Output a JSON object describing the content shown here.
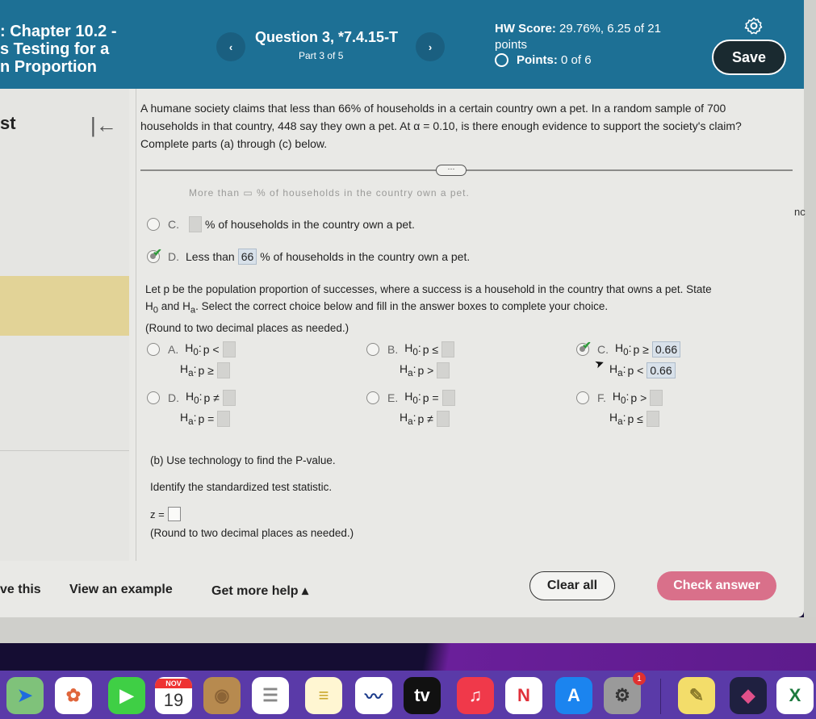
{
  "header": {
    "title_lines": [
      ": Chapter 10.2 -",
      "s Testing for a",
      "n Proportion"
    ],
    "question_title": "Question 3, *7.4.15-T",
    "question_part": "Part 3 of 5",
    "prev_icon": "‹",
    "next_icon": "›",
    "hw_score_label": "HW Score:",
    "hw_score_value": "29.76%, 6.25 of 21 points",
    "points_label": "Points:",
    "points_value": "0 of 6",
    "save_label": "Save"
  },
  "sidebar": {
    "title": "st",
    "collapse_icon": "|←"
  },
  "problem": {
    "text": "A humane society claims that less than 66% of households in a certain country own a pet. In a random sample of 700 households in that country, 448 say they own a pet. At α = 0.10, is there enough evidence to support the society's claim? Complete parts (a) through (c) below.",
    "more_label": "···",
    "faded_text": "More than ▭ % of households in the country own a pet."
  },
  "claim_options": [
    {
      "letter": "C.",
      "prefix": "",
      "value": "",
      "suffix": "% of households in the country own a pet.",
      "selected": false
    },
    {
      "letter": "D.",
      "prefix": "Less than",
      "value": "66",
      "suffix": "% of households in the country own a pet.",
      "selected": true
    }
  ],
  "instructions": {
    "line1": "Let p be the population proportion of successes, where a success is a household in the country that owns a pet. State",
    "h0": "H",
    "h0_sub": "0",
    "and": "and",
    "ha": "H",
    "ha_sub": "a",
    "line2_rest": ". Select the correct choice below and fill in the answer boxes to complete your choice.",
    "round_note": "(Round to two decimal places as needed.)"
  },
  "hypothesis_options": [
    {
      "letter": "A.",
      "h0_op": "p <",
      "ha_op": "p ≥",
      "h0_value": "",
      "ha_value": "",
      "selected": false
    },
    {
      "letter": "B.",
      "h0_op": "p ≤",
      "ha_op": "p >",
      "h0_value": "",
      "ha_value": "",
      "selected": false
    },
    {
      "letter": "C.",
      "h0_op": "p ≥",
      "ha_op": "p <",
      "h0_value": "0.66",
      "ha_value": "0.66",
      "selected": true
    },
    {
      "letter": "D.",
      "h0_op": "p ≠",
      "ha_op": "p =",
      "h0_value": "",
      "ha_value": "",
      "selected": false
    },
    {
      "letter": "E.",
      "h0_op": "p =",
      "ha_op": "p ≠",
      "h0_value": "",
      "ha_value": "",
      "selected": false
    },
    {
      "letter": "F.",
      "h0_op": "p >",
      "ha_op": "p ≤",
      "h0_value": "",
      "ha_value": "",
      "selected": false
    }
  ],
  "part_b": {
    "heading": "(b) Use technology to find the P-value.",
    "identify": "Identify the standardized test statistic.",
    "z_label": "z =",
    "z_value": "",
    "round_note": "(Round to two decimal places as needed.)"
  },
  "side_text": "nc",
  "footer": {
    "solve_label": "ve this",
    "example_label": "View an example",
    "help_label": "Get more help ▴",
    "clear_label": "Clear all",
    "check_label": "Check answer"
  },
  "dock": {
    "apps": [
      {
        "name": "maps",
        "glyph": "➤",
        "bg": "#7fc27a",
        "fg": "#1e6be0"
      },
      {
        "name": "photos",
        "glyph": "✿",
        "bg": "#ffffff",
        "fg": "#e0663c"
      },
      {
        "name": "facetime",
        "glyph": "▶",
        "bg": "#3fcf45",
        "fg": "#ffffff"
      },
      {
        "name": "calendar",
        "month": "NOV",
        "day": "19",
        "bg": "#ffffff",
        "fg": "#333333"
      },
      {
        "name": "contacts",
        "glyph": "◉",
        "bg": "#b78a4f",
        "fg": "#8c6436"
      },
      {
        "name": "reminders",
        "glyph": "☰",
        "bg": "#ffffff",
        "fg": "#888888"
      },
      {
        "name": "notes",
        "glyph": "≡",
        "bg": "#fff6d2",
        "fg": "#c9a72a"
      },
      {
        "name": "freeform",
        "glyph": "〰",
        "bg": "#ffffff",
        "fg": "#1a3a8a"
      },
      {
        "name": "apple-tv",
        "glyph": "tv",
        "bg": "#111111",
        "fg": "#ffffff"
      },
      {
        "name": "music",
        "glyph": "♫",
        "bg": "#f0394a",
        "fg": "#ffffff"
      },
      {
        "name": "news",
        "glyph": "N",
        "bg": "#ffffff",
        "fg": "#e0303a"
      },
      {
        "name": "app-store",
        "glyph": "A",
        "bg": "#1b84ef",
        "fg": "#ffffff"
      },
      {
        "name": "system-settings",
        "glyph": "⚙",
        "bg": "#9a9a9a",
        "fg": "#333333",
        "badge": "1"
      },
      {
        "name": "stickies",
        "glyph": "✎",
        "bg": "#f3dd6a",
        "fg": "#8a7a2a"
      },
      {
        "name": "shortcuts",
        "glyph": "◆",
        "bg": "#1f2040",
        "fg": "#e0508a"
      },
      {
        "name": "excel",
        "glyph": "X",
        "bg": "#ffffff",
        "fg": "#1d7a3e"
      }
    ]
  }
}
